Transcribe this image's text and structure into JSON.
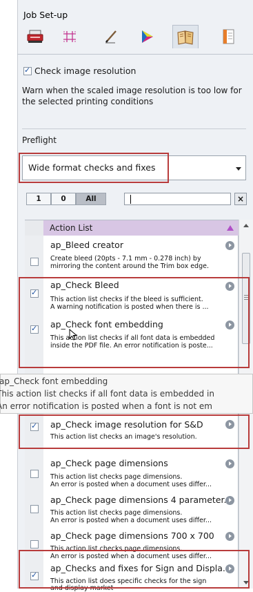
{
  "panel": {
    "title": "Job Set-up"
  },
  "toolbar": {
    "icons": [
      "printer-icon",
      "grid-icon",
      "pen-icon",
      "color-wheel-icon",
      "book-icon",
      "page-layout-icon"
    ],
    "active_index": 4
  },
  "check_resolution": {
    "label": "Check image resolution",
    "checked": true,
    "description_line1": "Warn when the scaled image resolution is too low for",
    "description_line2": "the selected printing conditions"
  },
  "preflight": {
    "heading": "Preflight",
    "selected": "Wide format checks and fixes"
  },
  "filter": {
    "segments": [
      "1",
      "0",
      "All"
    ],
    "selected_segment": "All",
    "search_value": "",
    "clear_label": "×"
  },
  "action_list": {
    "header": "Action List",
    "items": [
      {
        "title": "ap_Bleed creator",
        "checked": false,
        "desc1": "Create bleed (20pts - 7.1 mm - 0.278 inch) by",
        "desc2": "mirroring the content around the Trim box edge."
      },
      {
        "title": "ap_Check Bleed",
        "checked": true,
        "desc1": "This action list checks if the bleed is sufficient.",
        "desc2": "A warning notification is posted when there is ..."
      },
      {
        "title": "ap_Check font embedding",
        "checked": true,
        "desc1": "This action list checks if all font data is embedded",
        "desc2": "inside the PDF file. An error notification is poste..."
      },
      {
        "title": "ap_Check image resolution for S&D",
        "checked": true,
        "desc1": "This action list checks an image's resolution.",
        "desc2": ""
      },
      {
        "title": "ap_Check page dimensions",
        "checked": false,
        "desc1": "This action list checks page dimensions.",
        "desc2": "An error is posted when a document uses differ..."
      },
      {
        "title": "ap_Check page dimensions 4 parameter...",
        "checked": false,
        "desc1": "This action list checks page dimensions.",
        "desc2": "An error is posted when a document uses differ..."
      },
      {
        "title": "ap_Check page dimensions 700 x 700",
        "checked": false,
        "desc1": "This action list checks page dimensions.",
        "desc2": "An error is posted when a document uses differ..."
      },
      {
        "title": "ap_Checks and fixes for Sign and Displa...",
        "checked": true,
        "desc1": "This action list does specific checks for the sign",
        "desc2": "and display market"
      }
    ]
  },
  "tooltip": {
    "line1": "ap_Check font embedding",
    "line2": "This action list checks if all font data is embedded in",
    "line3": "An error notification is posted when a font is not em"
  }
}
